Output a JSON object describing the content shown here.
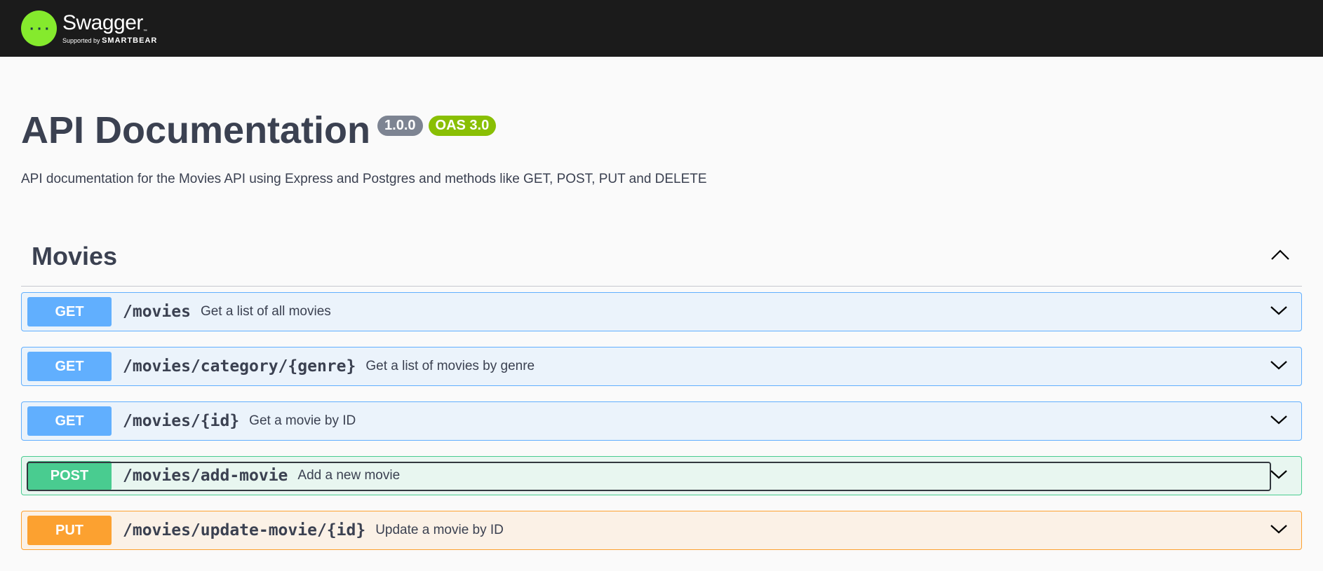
{
  "brand": {
    "name": "Swagger",
    "tm": "™",
    "supported_by": "Supported by",
    "company": "SMARTBEAR",
    "logo_icon": "swagger-logo-icon",
    "accent": "#85ea2d"
  },
  "info": {
    "title": "API Documentation",
    "version": "1.0.0",
    "spec": "OAS 3.0",
    "description": "API documentation for the Movies API using Express and Postgres and methods like GET, POST, PUT and DELETE"
  },
  "tag": {
    "name": "Movies",
    "expanded": true
  },
  "operations": [
    {
      "method": "GET",
      "path": "/movies",
      "summary": "Get a list of all movies",
      "color": "#61affe"
    },
    {
      "method": "GET",
      "path": "/movies/category/{genre}",
      "summary": "Get a list of movies by genre",
      "color": "#61affe"
    },
    {
      "method": "GET",
      "path": "/movies/{id}",
      "summary": "Get a movie by ID",
      "color": "#61affe"
    },
    {
      "method": "POST",
      "path": "/movies/add-movie",
      "summary": "Add a new movie",
      "color": "#49cc90"
    },
    {
      "method": "PUT",
      "path": "/movies/update-movie/{id}",
      "summary": "Update a movie by ID",
      "color": "#fca130"
    }
  ]
}
